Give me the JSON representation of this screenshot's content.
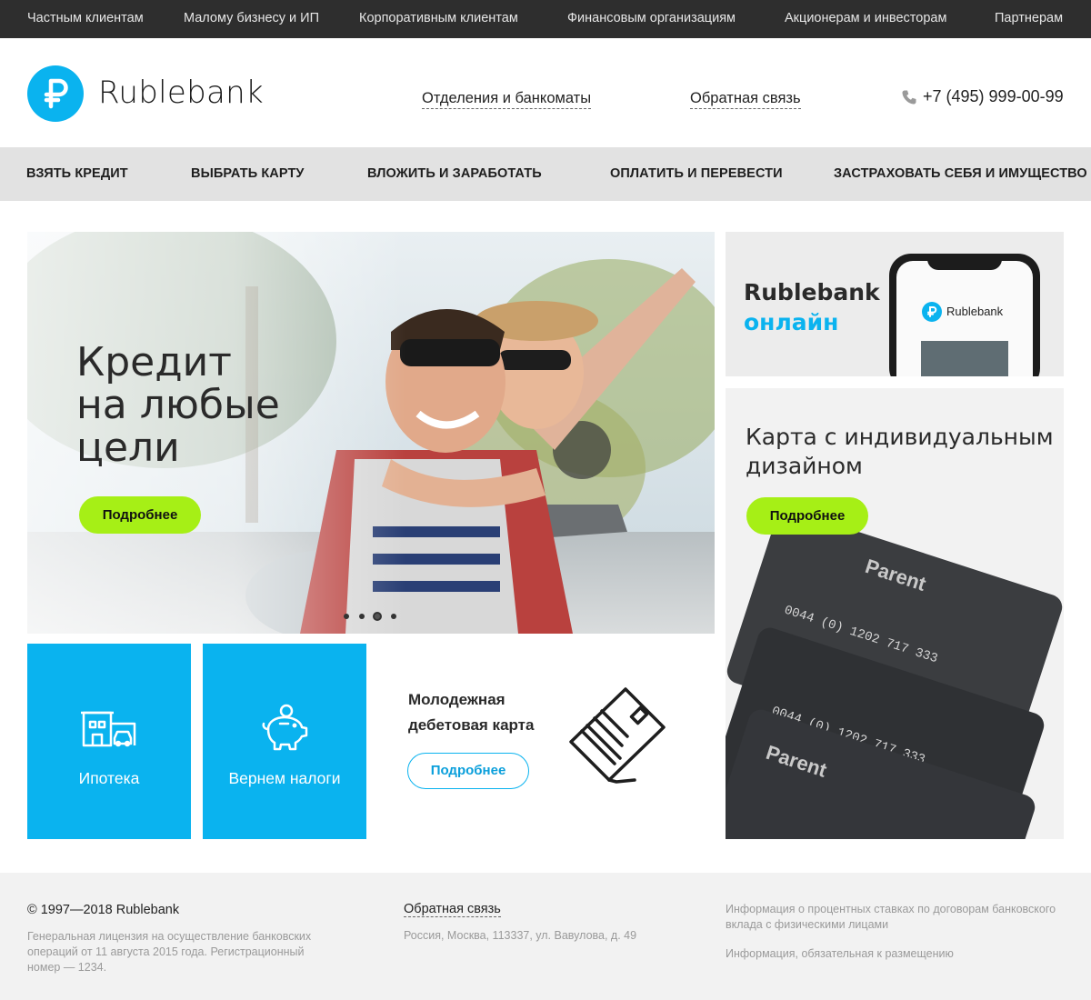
{
  "top_nav": [
    "Частным клиентам",
    "Малому бизнесу и ИП",
    "Корпоративным клиентам",
    "Финансовым организациям",
    "Акционерам и инвесторам",
    "Партнерам"
  ],
  "header": {
    "logo_symbol": "₽",
    "logo_text": "Rublebank",
    "links": [
      "Отделения и банкоматы",
      "Обратная связь"
    ],
    "phone": "+7 (495) 999-00-99"
  },
  "main_nav": [
    "Взять кредит",
    "Выбрать карту",
    "Вложить и заработать",
    "Оплатить и перевести",
    "Застраховать себя и имущество"
  ],
  "hero": {
    "title_lines": [
      "Кредит",
      "на любые",
      "цели"
    ],
    "button": "Подробнее",
    "slides_total": 4,
    "active_slide": 3
  },
  "online_card": {
    "title_line1": "Rublebank",
    "title_line2": "онлайн",
    "phone_logo_text": "Rublebank"
  },
  "custom_card": {
    "title_lines": [
      "Карта с индивидуальным",
      "дизайном"
    ],
    "button": "Подробнее",
    "card_brand": "Parent",
    "card_number": "0044 (0) 1202 717 333"
  },
  "tiles": [
    {
      "label": "Ипотека",
      "icon": "house-car-icon"
    },
    {
      "label": "Вернем налоги",
      "icon": "piggy-bank-icon"
    }
  ],
  "youth_card": {
    "title_lines": [
      "Молодежная",
      "дебетовая карта"
    ],
    "button": "Подробнее",
    "icon": "card-in-hand-icon"
  },
  "footer": {
    "copyright": "© 1997—2018 Rublebank",
    "license": "Генеральная лицензия на осуществление банковских операций от 11 августа 2015 года. Регистрационный номер — 1234.",
    "feedback": "Обратная связь",
    "address": "Россия, Москва, 113337, ул. Вавулова, д. 49",
    "info1": "Информация о процентных ставках по договорам банковского вклада с физическими лицами",
    "info2": "Информация, обязательная к размещению"
  },
  "colors": {
    "accent_blue": "#0ab3ef",
    "accent_green": "#a6ef16",
    "topbar": "#2e2e2e",
    "nav_bg": "#e2e2e2"
  }
}
